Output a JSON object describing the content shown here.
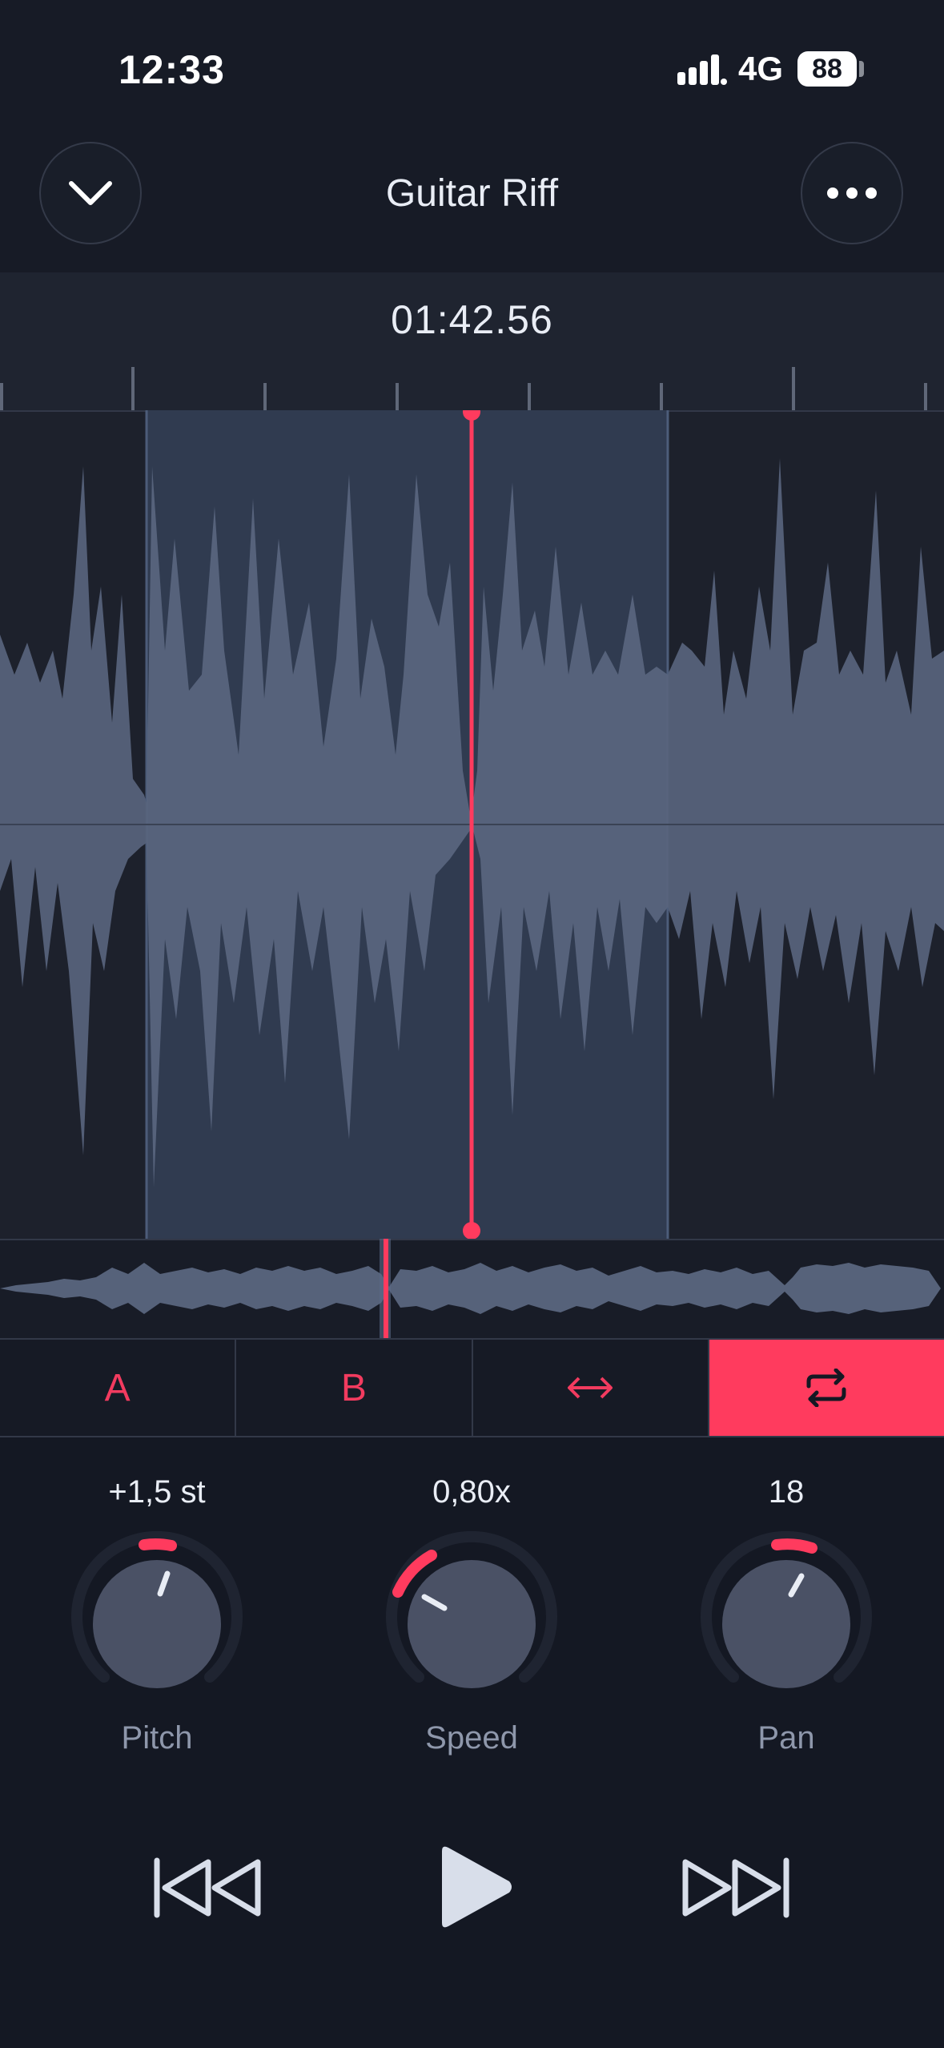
{
  "status": {
    "time": "12:33",
    "network": "4G",
    "battery": "88"
  },
  "header": {
    "title": "Guitar Riff",
    "left_icon": "chevron-down-icon",
    "right_icon": "more-icon"
  },
  "timeline": {
    "timecode": "01:42.56"
  },
  "controls": {
    "a_label": "A",
    "b_label": "B",
    "stretch_icon": "swap-arrows-icon",
    "loop_icon": "loop-icon",
    "loop_active": true
  },
  "knobs": [
    {
      "label": "Pitch",
      "value": "+1,5 st"
    },
    {
      "label": "Speed",
      "value": "0,80x"
    },
    {
      "label": "Pan",
      "value": "18"
    }
  ],
  "transport": {
    "prev_icon": "skip-back-icon",
    "play_icon": "play-icon",
    "next_icon": "skip-forward-icon"
  },
  "colors": {
    "accent": "#FF3B5E",
    "background": "#141823",
    "waveform": "#56627A",
    "selection": "#283346"
  }
}
